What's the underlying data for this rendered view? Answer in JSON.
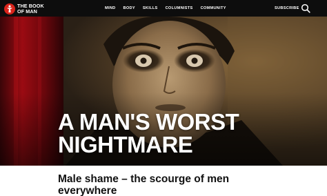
{
  "header": {
    "logo": {
      "line1": "THE BOOK",
      "line2": "OF MAN"
    },
    "nav": [
      {
        "label": "MIND"
      },
      {
        "label": "BODY"
      },
      {
        "label": "SKILLS"
      },
      {
        "label": "COLUMNISTS"
      },
      {
        "label": "COMMUNITY"
      }
    ],
    "subscribe_label": "SUBSCRIBE",
    "search_icon": "search-icon"
  },
  "hero": {
    "title_line1": "A MAN'S WORST",
    "title_line2": "NIGHTMARE",
    "image": "sepia-portrait-staring-man"
  },
  "article": {
    "standfirst": "Male shame – the scourge of men everywhere"
  },
  "colors": {
    "header_bg": "#0d0d0d",
    "logo_red": "#d9241b",
    "text_light": "#ffffff",
    "text_dark": "#111111"
  }
}
